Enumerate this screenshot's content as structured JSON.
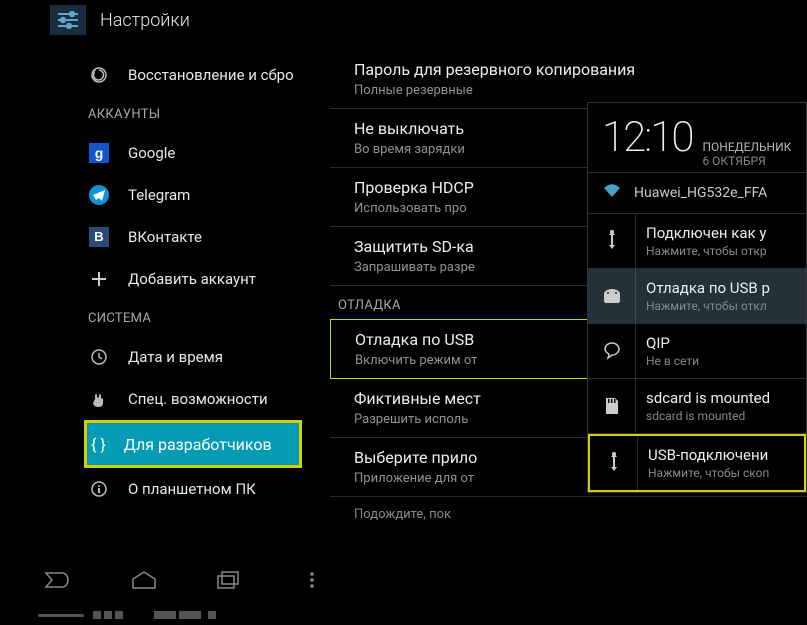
{
  "header": {
    "title": "Настройки"
  },
  "sidebar": {
    "restore": "Восстановление и сбро",
    "sect_accounts": "АККАУНТЫ",
    "google": "Google",
    "telegram": "Telegram",
    "vk": "ВКонтакте",
    "add_account": "Добавить аккаунт",
    "sect_system": "СИСТЕМА",
    "datetime": "Дата и время",
    "accessibility": "Спец. возможности",
    "developer": "Для разработчиков",
    "about": "О планшетном ПК"
  },
  "detail": {
    "items": [
      {
        "t": "Пароль для резервного копирования",
        "s": "Полные резервные"
      },
      {
        "t": "Не выключать",
        "s": "Во время зарядки"
      },
      {
        "t": "Проверка HDCP",
        "s": "Использовать про"
      },
      {
        "t": "Защитить SD-ка",
        "s": "Запрашивать разре"
      }
    ],
    "sect_debug": "ОТЛАДКА",
    "usb_debug": {
      "t": "Отладка по USB",
      "s": "Включить режим от"
    },
    "items2": [
      {
        "t": "Фиктивные мест",
        "s": "Разрешить исполь"
      },
      {
        "t": "Выберите прило",
        "s": "Приложение для от"
      }
    ],
    "footer": "Подождите, пок"
  },
  "panel": {
    "time": "12:10",
    "day": "ПОНЕДЕЛЬНИК",
    "date": "6 ОКТЯБРЯ",
    "wifi": "Huawei_HG532e_FFA",
    "rows": [
      {
        "t": "Подключен как у",
        "s": "Нажмите, чтобы откр"
      },
      {
        "t": "Отладка по USB р",
        "s": "Нажмите, чтобы откл"
      },
      {
        "t": "QIP",
        "s": "Не в сети"
      },
      {
        "t": "sdcard is mounted",
        "s": "sdcard is mounted"
      },
      {
        "t": "USB-подключени",
        "s": "Нажмите, чтобы скоп"
      }
    ]
  }
}
